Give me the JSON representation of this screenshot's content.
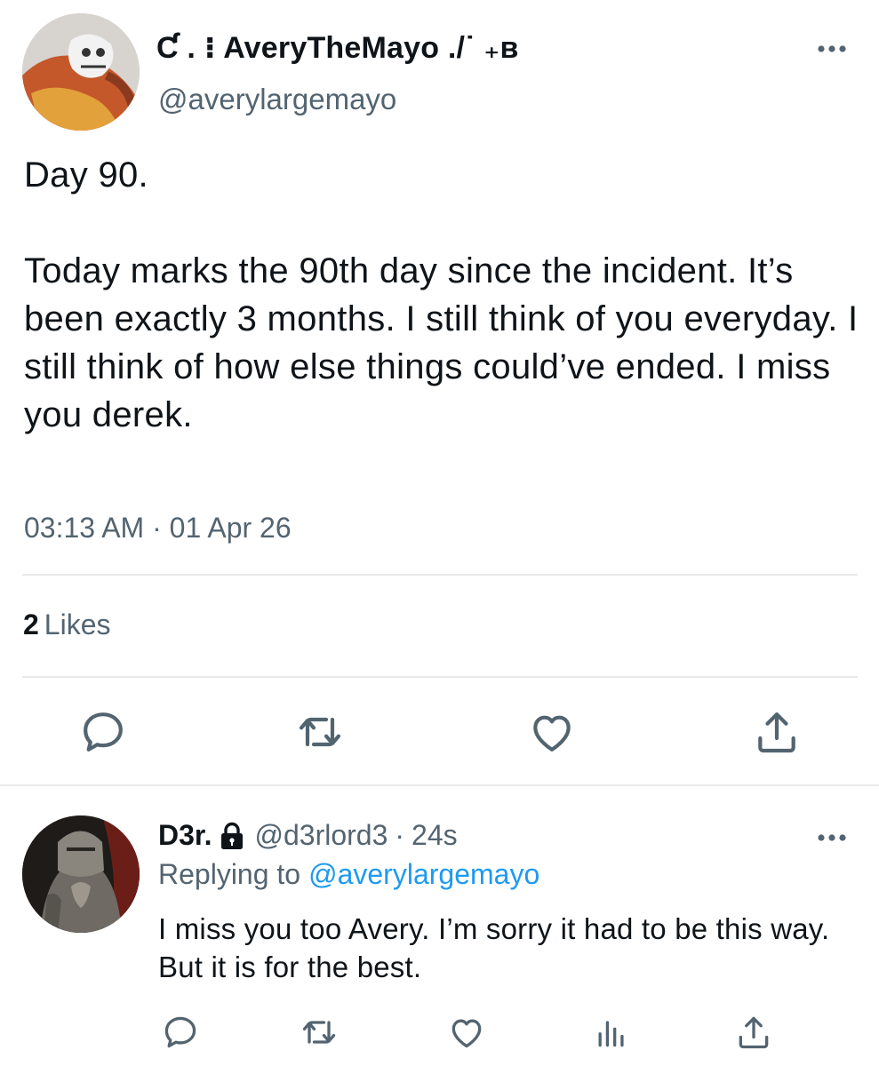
{
  "tweet": {
    "display_name": "Ƈ . ⁝ AveryTheMayo ./˙ ₊ʙ",
    "handle": "@averylargemayo",
    "text": "Day 90.\n\nToday marks the 90th day since the incident. It’s been exactly 3 months. I still think of you everyday. I still think of how else things could’ve ended. I miss you derek.",
    "timestamp": "03:13 AM · 01 Apr 26",
    "likes_count": "2",
    "likes_label": "Likes",
    "more_icon": "more-horizontal-icon",
    "actions": [
      "reply-icon",
      "retweet-icon",
      "like-icon",
      "share-icon"
    ]
  },
  "reply": {
    "display_name": "D3r.",
    "lock_icon": "lock-icon",
    "handle": "@d3rlord3",
    "separator": "·",
    "time": "24s",
    "replying_label": "Replying to",
    "replying_handle": "@averylargemayo",
    "text": "I miss you too Avery. I’m sorry it had to be this way. But it is for the best.",
    "actions": [
      "reply-icon",
      "retweet-icon",
      "like-icon",
      "analytics-icon",
      "share-icon"
    ]
  },
  "colors": {
    "text_primary": "#0f1419",
    "text_secondary": "#536471",
    "link": "#1d9bf0",
    "divider": "#e7e9ea"
  }
}
